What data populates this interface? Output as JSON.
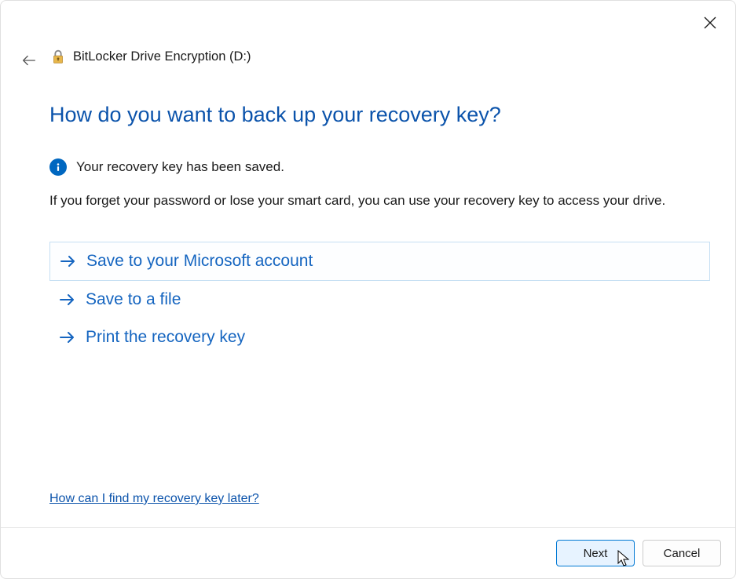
{
  "window": {
    "title": "BitLocker Drive Encryption (D:)"
  },
  "main": {
    "heading": "How do you want to back up your recovery key?",
    "info_text": "Your recovery key has been saved.",
    "description": "If you forget your password or lose your smart card, you can use your recovery key to access your drive."
  },
  "options": [
    {
      "label": "Save to your Microsoft account",
      "selected": true
    },
    {
      "label": "Save to a file",
      "selected": false
    },
    {
      "label": "Print the recovery key",
      "selected": false
    }
  ],
  "help_link": "How can I find my recovery key later?",
  "buttons": {
    "next": "Next",
    "cancel": "Cancel"
  }
}
